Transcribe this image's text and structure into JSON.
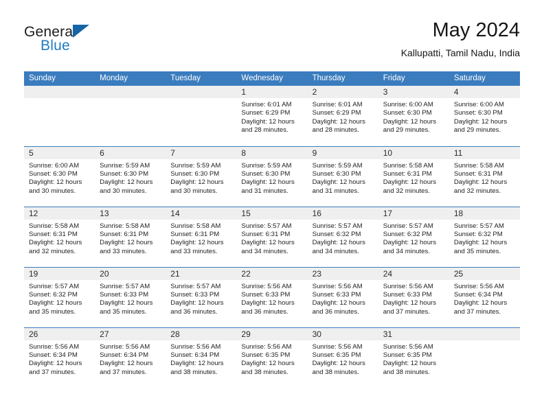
{
  "brand": {
    "word1": "General",
    "word2": "Blue",
    "triangle_color": "#1565a6",
    "blue_text_color": "#1f7bc1",
    "icon": "general-blue-logo"
  },
  "header": {
    "month_title": "May 2024",
    "location": "Kallupatti, Tamil Nadu, India"
  },
  "theme": {
    "header_row_bg": "#3a7cbe",
    "date_strip_bg": "#efefef",
    "row_divider": "#3a7cbe",
    "text": "#1e1e1e"
  },
  "labels": {
    "sunrise": "Sunrise:",
    "sunset": "Sunset:",
    "daylight_prefix": "Daylight:"
  },
  "day_headers": [
    "Sunday",
    "Monday",
    "Tuesday",
    "Wednesday",
    "Thursday",
    "Friday",
    "Saturday"
  ],
  "weeks": [
    [
      {
        "date": "",
        "lines": [
          "",
          "",
          "",
          ""
        ]
      },
      {
        "date": "",
        "lines": [
          "",
          "",
          "",
          ""
        ]
      },
      {
        "date": "",
        "lines": [
          "",
          "",
          "",
          ""
        ]
      },
      {
        "date": "1",
        "lines": [
          "Sunrise: 6:01 AM",
          "Sunset: 6:29 PM",
          "Daylight: 12 hours",
          "and 28 minutes."
        ]
      },
      {
        "date": "2",
        "lines": [
          "Sunrise: 6:01 AM",
          "Sunset: 6:29 PM",
          "Daylight: 12 hours",
          "and 28 minutes."
        ]
      },
      {
        "date": "3",
        "lines": [
          "Sunrise: 6:00 AM",
          "Sunset: 6:30 PM",
          "Daylight: 12 hours",
          "and 29 minutes."
        ]
      },
      {
        "date": "4",
        "lines": [
          "Sunrise: 6:00 AM",
          "Sunset: 6:30 PM",
          "Daylight: 12 hours",
          "and 29 minutes."
        ]
      }
    ],
    [
      {
        "date": "5",
        "lines": [
          "Sunrise: 6:00 AM",
          "Sunset: 6:30 PM",
          "Daylight: 12 hours",
          "and 30 minutes."
        ]
      },
      {
        "date": "6",
        "lines": [
          "Sunrise: 5:59 AM",
          "Sunset: 6:30 PM",
          "Daylight: 12 hours",
          "and 30 minutes."
        ]
      },
      {
        "date": "7",
        "lines": [
          "Sunrise: 5:59 AM",
          "Sunset: 6:30 PM",
          "Daylight: 12 hours",
          "and 30 minutes."
        ]
      },
      {
        "date": "8",
        "lines": [
          "Sunrise: 5:59 AM",
          "Sunset: 6:30 PM",
          "Daylight: 12 hours",
          "and 31 minutes."
        ]
      },
      {
        "date": "9",
        "lines": [
          "Sunrise: 5:59 AM",
          "Sunset: 6:30 PM",
          "Daylight: 12 hours",
          "and 31 minutes."
        ]
      },
      {
        "date": "10",
        "lines": [
          "Sunrise: 5:58 AM",
          "Sunset: 6:31 PM",
          "Daylight: 12 hours",
          "and 32 minutes."
        ]
      },
      {
        "date": "11",
        "lines": [
          "Sunrise: 5:58 AM",
          "Sunset: 6:31 PM",
          "Daylight: 12 hours",
          "and 32 minutes."
        ]
      }
    ],
    [
      {
        "date": "12",
        "lines": [
          "Sunrise: 5:58 AM",
          "Sunset: 6:31 PM",
          "Daylight: 12 hours",
          "and 32 minutes."
        ]
      },
      {
        "date": "13",
        "lines": [
          "Sunrise: 5:58 AM",
          "Sunset: 6:31 PM",
          "Daylight: 12 hours",
          "and 33 minutes."
        ]
      },
      {
        "date": "14",
        "lines": [
          "Sunrise: 5:58 AM",
          "Sunset: 6:31 PM",
          "Daylight: 12 hours",
          "and 33 minutes."
        ]
      },
      {
        "date": "15",
        "lines": [
          "Sunrise: 5:57 AM",
          "Sunset: 6:31 PM",
          "Daylight: 12 hours",
          "and 34 minutes."
        ]
      },
      {
        "date": "16",
        "lines": [
          "Sunrise: 5:57 AM",
          "Sunset: 6:32 PM",
          "Daylight: 12 hours",
          "and 34 minutes."
        ]
      },
      {
        "date": "17",
        "lines": [
          "Sunrise: 5:57 AM",
          "Sunset: 6:32 PM",
          "Daylight: 12 hours",
          "and 34 minutes."
        ]
      },
      {
        "date": "18",
        "lines": [
          "Sunrise: 5:57 AM",
          "Sunset: 6:32 PM",
          "Daylight: 12 hours",
          "and 35 minutes."
        ]
      }
    ],
    [
      {
        "date": "19",
        "lines": [
          "Sunrise: 5:57 AM",
          "Sunset: 6:32 PM",
          "Daylight: 12 hours",
          "and 35 minutes."
        ]
      },
      {
        "date": "20",
        "lines": [
          "Sunrise: 5:57 AM",
          "Sunset: 6:33 PM",
          "Daylight: 12 hours",
          "and 35 minutes."
        ]
      },
      {
        "date": "21",
        "lines": [
          "Sunrise: 5:57 AM",
          "Sunset: 6:33 PM",
          "Daylight: 12 hours",
          "and 36 minutes."
        ]
      },
      {
        "date": "22",
        "lines": [
          "Sunrise: 5:56 AM",
          "Sunset: 6:33 PM",
          "Daylight: 12 hours",
          "and 36 minutes."
        ]
      },
      {
        "date": "23",
        "lines": [
          "Sunrise: 5:56 AM",
          "Sunset: 6:33 PM",
          "Daylight: 12 hours",
          "and 36 minutes."
        ]
      },
      {
        "date": "24",
        "lines": [
          "Sunrise: 5:56 AM",
          "Sunset: 6:33 PM",
          "Daylight: 12 hours",
          "and 37 minutes."
        ]
      },
      {
        "date": "25",
        "lines": [
          "Sunrise: 5:56 AM",
          "Sunset: 6:34 PM",
          "Daylight: 12 hours",
          "and 37 minutes."
        ]
      }
    ],
    [
      {
        "date": "26",
        "lines": [
          "Sunrise: 5:56 AM",
          "Sunset: 6:34 PM",
          "Daylight: 12 hours",
          "and 37 minutes."
        ]
      },
      {
        "date": "27",
        "lines": [
          "Sunrise: 5:56 AM",
          "Sunset: 6:34 PM",
          "Daylight: 12 hours",
          "and 37 minutes."
        ]
      },
      {
        "date": "28",
        "lines": [
          "Sunrise: 5:56 AM",
          "Sunset: 6:34 PM",
          "Daylight: 12 hours",
          "and 38 minutes."
        ]
      },
      {
        "date": "29",
        "lines": [
          "Sunrise: 5:56 AM",
          "Sunset: 6:35 PM",
          "Daylight: 12 hours",
          "and 38 minutes."
        ]
      },
      {
        "date": "30",
        "lines": [
          "Sunrise: 5:56 AM",
          "Sunset: 6:35 PM",
          "Daylight: 12 hours",
          "and 38 minutes."
        ]
      },
      {
        "date": "31",
        "lines": [
          "Sunrise: 5:56 AM",
          "Sunset: 6:35 PM",
          "Daylight: 12 hours",
          "and 38 minutes."
        ]
      },
      {
        "date": "",
        "lines": [
          "",
          "",
          "",
          ""
        ]
      }
    ]
  ]
}
